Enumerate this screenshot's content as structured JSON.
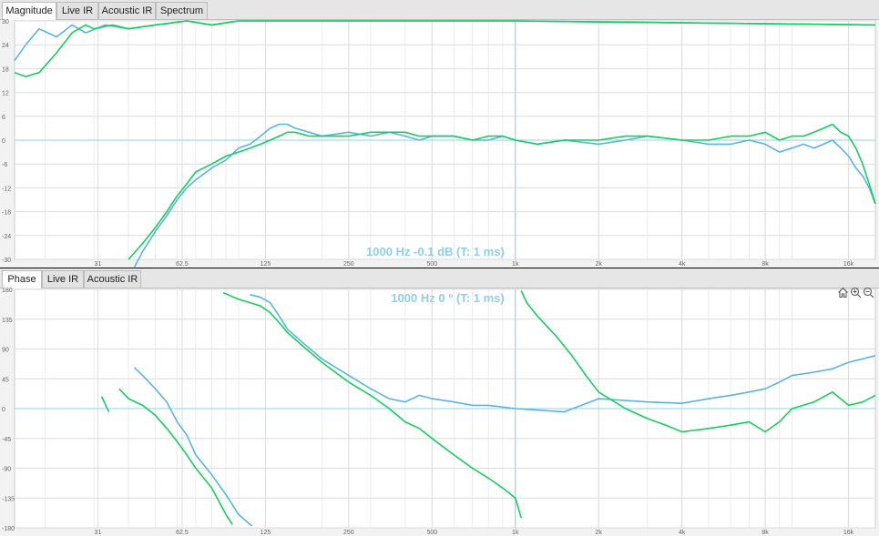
{
  "top_tabs": [
    {
      "label": "Magnitude",
      "active": true
    },
    {
      "label": "Live IR",
      "active": false
    },
    {
      "label": "Acoustic IR",
      "active": false
    },
    {
      "label": "Spectrum",
      "active": false
    }
  ],
  "bottom_tabs": [
    {
      "label": "Phase",
      "active": true
    },
    {
      "label": "Live IR",
      "active": false
    },
    {
      "label": "Acoustic IR",
      "active": false
    }
  ],
  "magnitude_readout": "1000 Hz  -0.1 dB  (T: 1 ms)",
  "phase_readout": "1000 Hz  0 °  (T: 1 ms)",
  "toolbar_icons": [
    "home-icon",
    "zoom-in-icon",
    "zoom-out-icon"
  ],
  "colors": {
    "series_blue": "#58b5e0",
    "series_green": "#13cf5c",
    "cursor": "#8fd3e5"
  },
  "chart_data": [
    {
      "type": "line",
      "x_scale": "log",
      "xlim": [
        15.5,
        20000
      ],
      "ylim": [
        -30,
        30
      ],
      "x_ticks": [
        31,
        62.5,
        125,
        250,
        500,
        1000,
        2000,
        4000,
        8000,
        16000
      ],
      "x_tick_labels": [
        "31",
        "62.5",
        "125",
        "250",
        "500",
        "1k",
        "2k",
        "4k",
        "8k",
        "16k"
      ],
      "y_ticks": [
        30,
        24,
        18,
        12,
        6,
        0,
        -6,
        -12,
        -18,
        -24,
        -30
      ],
      "cursor": {
        "x": 1000,
        "y": 0
      },
      "grid": true,
      "series": [
        {
          "color": "#58b5e0",
          "x": [
            15.5,
            17,
            19,
            22,
            25,
            28,
            33,
            40,
            50,
            65,
            80,
            100,
            200,
            1000,
            20000
          ],
          "y": [
            20,
            24,
            28,
            26,
            29,
            27,
            29,
            28,
            29,
            30,
            29,
            30,
            30,
            30,
            29
          ]
        },
        {
          "color": "#13cf5c",
          "x": [
            15.5,
            17,
            19,
            22,
            25,
            28,
            30,
            35,
            40,
            50,
            65,
            80,
            100,
            200,
            1000,
            20000
          ],
          "y": [
            17,
            16,
            17,
            22,
            27,
            29,
            28,
            29,
            28,
            29,
            30,
            29,
            30,
            30,
            30,
            29
          ]
        },
        {
          "color": "#58b5e0",
          "x": [
            42,
            45,
            50,
            55,
            60,
            65,
            70,
            80,
            90,
            100,
            110,
            120,
            130,
            140,
            150,
            160,
            180,
            200,
            250,
            300,
            350,
            400,
            450,
            500,
            600,
            700,
            800,
            900,
            1000,
            1200,
            1500,
            2000,
            2500,
            3000,
            4000,
            5000,
            6000,
            7000,
            8000,
            9000,
            10000,
            11000,
            12000,
            13000,
            14000,
            15000,
            16000,
            17000,
            18000,
            19000,
            20000
          ],
          "y": [
            -32,
            -28,
            -23,
            -19,
            -15,
            -12,
            -10,
            -7,
            -5,
            -2,
            -1,
            1,
            3,
            4,
            4,
            3,
            2,
            1,
            2,
            1,
            2,
            1,
            0,
            1,
            1,
            0,
            0,
            1,
            0,
            -1,
            0,
            -1,
            0,
            1,
            0,
            -1,
            -1,
            0,
            -1,
            -3,
            -2,
            -1,
            -2,
            -1,
            0,
            -2,
            -4,
            -7,
            -9,
            -12,
            -16
          ]
        },
        {
          "color": "#13cf5c",
          "x": [
            40,
            45,
            50,
            55,
            60,
            65,
            70,
            80,
            90,
            100,
            110,
            120,
            130,
            140,
            150,
            160,
            180,
            200,
            250,
            300,
            350,
            400,
            450,
            500,
            600,
            700,
            800,
            900,
            1000,
            1200,
            1500,
            2000,
            2500,
            3000,
            4000,
            5000,
            6000,
            7000,
            8000,
            9000,
            10000,
            11000,
            12000,
            13000,
            14000,
            15000,
            16000,
            17000,
            18000,
            19000,
            20000
          ],
          "y": [
            -30,
            -26,
            -22,
            -18,
            -14,
            -11,
            -8,
            -6,
            -4,
            -3,
            -2,
            -1,
            0,
            1,
            2,
            2,
            1,
            1,
            1,
            2,
            2,
            2,
            1,
            1,
            1,
            0,
            1,
            1,
            0,
            -1,
            0,
            0,
            1,
            1,
            0,
            0,
            1,
            1,
            2,
            0,
            1,
            1,
            2,
            3,
            4,
            2,
            1,
            -2,
            -6,
            -11,
            -16
          ]
        }
      ]
    },
    {
      "type": "line",
      "x_scale": "log",
      "xlim": [
        15.5,
        20000
      ],
      "ylim": [
        -180,
        180
      ],
      "x_ticks": [
        31,
        62.5,
        125,
        250,
        500,
        1000,
        2000,
        4000,
        8000,
        16000
      ],
      "x_tick_labels": [
        "31",
        "62.5",
        "125",
        "250",
        "500",
        "1k",
        "2k",
        "4k",
        "8k",
        "16k"
      ],
      "y_ticks": [
        180,
        135,
        90,
        45,
        0,
        -45,
        -90,
        -135,
        -180
      ],
      "cursor": {
        "x": 1000,
        "y": 0
      },
      "grid": true,
      "series": [
        {
          "color": "#13cf5c",
          "x": [
            32,
            34
          ],
          "y": [
            18,
            -5
          ]
        },
        {
          "color": "#13cf5c",
          "x": [
            37,
            40,
            45,
            50,
            55,
            60,
            65,
            70,
            80,
            90,
            95
          ],
          "y": [
            30,
            15,
            5,
            -10,
            -30,
            -50,
            -70,
            -90,
            -120,
            -160,
            -175
          ]
        },
        {
          "color": "#58b5e0",
          "x": [
            42,
            45,
            50,
            55,
            60,
            65,
            70,
            80,
            90,
            100,
            110,
            112
          ],
          "y": [
            62,
            50,
            30,
            10,
            -20,
            -40,
            -70,
            -100,
            -130,
            -160,
            -175,
            -177
          ]
        },
        {
          "color": "#13cf5c",
          "x": [
            88,
            100,
            110,
            120,
            130,
            140,
            150,
            170,
            200,
            250,
            300,
            350,
            400,
            450,
            500,
            600,
            700,
            800,
            900,
            1000,
            1050
          ],
          "y": [
            175,
            165,
            160,
            155,
            145,
            130,
            115,
            95,
            70,
            40,
            20,
            0,
            -20,
            -30,
            -45,
            -70,
            -90,
            -105,
            -120,
            -135,
            -165
          ]
        },
        {
          "color": "#58b5e0",
          "x": [
            110,
            120,
            130,
            140,
            150,
            170,
            200,
            250,
            300,
            350,
            400,
            450,
            500,
            600,
            700,
            800,
            1000,
            1500,
            2000,
            3000,
            4000,
            5000,
            6000,
            7000,
            8000,
            9000,
            10000,
            12000,
            14000,
            16000,
            18000,
            20000
          ],
          "y": [
            172,
            168,
            160,
            140,
            120,
            100,
            75,
            50,
            30,
            15,
            10,
            20,
            15,
            10,
            5,
            5,
            0,
            -5,
            15,
            10,
            8,
            15,
            20,
            25,
            30,
            40,
            50,
            55,
            60,
            70,
            75,
            80
          ]
        },
        {
          "color": "#13cf5c",
          "x": [
            1050,
            1100,
            1200,
            1400,
            1600,
            1800,
            2000,
            2500,
            3000,
            3500,
            4000,
            5000,
            6000,
            7000,
            8000,
            9000,
            10000,
            12000,
            14000,
            16000,
            18000,
            20000
          ],
          "y": [
            178,
            160,
            140,
            110,
            80,
            50,
            25,
            0,
            -15,
            -25,
            -35,
            -30,
            -25,
            -20,
            -35,
            -20,
            0,
            10,
            25,
            5,
            10,
            20
          ]
        }
      ]
    }
  ]
}
